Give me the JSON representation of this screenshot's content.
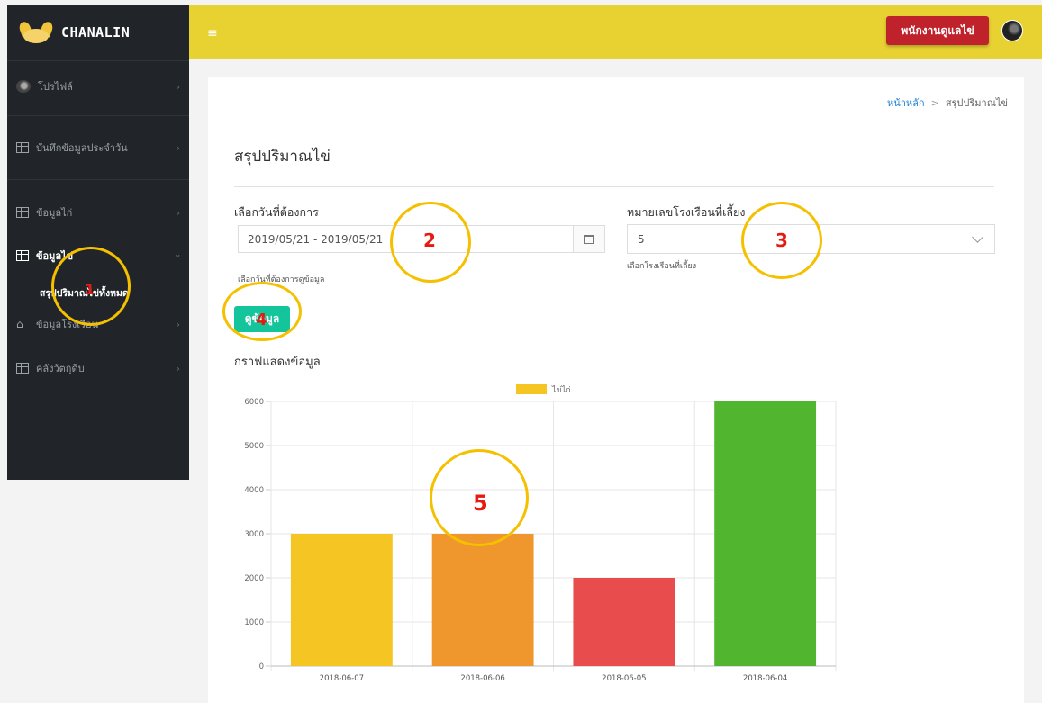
{
  "brand": {
    "name": "CHANALIN"
  },
  "sidebar": {
    "items": [
      {
        "label": "โปรไฟล์",
        "icon": "avatar"
      },
      {
        "label": "บันทึกข้อมูลประจำวัน",
        "icon": "table-icon"
      },
      {
        "label": "ข้อมูลไก่",
        "icon": "table-icon"
      },
      {
        "label": "ข้อมูลไข่",
        "icon": "table-icon"
      },
      {
        "label": "ข้อมูลโรงเรือน",
        "icon": "home-icon"
      },
      {
        "label": "คลังวัตถุดิบ",
        "icon": "table-icon"
      }
    ],
    "sub_item": "สรุปปริมาณไข่ทั้งหมด"
  },
  "topbar": {
    "menu_icon": "hamburger-icon",
    "role_button": "พนักงานดูแลไข่"
  },
  "breadcrumb": {
    "home": "หน้าหลัก",
    "separator": ">",
    "current": "สรุปปริมาณไข่"
  },
  "page": {
    "title": "สรุปปริมาณไข่"
  },
  "form": {
    "date_label": "เลือกวันที่ต้องการ",
    "date_value": "2019/05/21 - 2019/05/21",
    "date_help": "เลือกวันที่ต้องการดูข้อมูล",
    "house_label": "หมายเลขโรงเรือนที่เลี้ยง",
    "house_value": "5",
    "house_help": "เลือกโรงเรือนที่เลี้ยง",
    "view_button": "ดูข้อมูล"
  },
  "chart_heading": "กราฟแสดงข้อมูล",
  "chart_data": {
    "type": "bar",
    "categories": [
      "2018-06-07",
      "2018-06-06",
      "2018-06-05",
      "2018-06-04"
    ],
    "series": [
      {
        "name": "ไข่ไก่",
        "values": [
          3000,
          3000,
          2000,
          6000
        ]
      }
    ],
    "bar_colors": [
      "#f5c523",
      "#ef962d",
      "#e84c4c",
      "#52b530"
    ],
    "legend_color": "#f5c523",
    "legend_position": "top",
    "yticks": [
      0,
      1000,
      2000,
      3000,
      4000,
      5000,
      6000
    ],
    "ylim": [
      0,
      6000
    ],
    "grid": true
  },
  "annotations": [
    "1",
    "2",
    "3",
    "4",
    "5"
  ],
  "colors": {
    "sidebar": "#212529",
    "topbar": "#e8d232",
    "role_button": "#c0222c",
    "view_button": "#14c49a",
    "annotation_ring": "#f5c000",
    "annotation_number": "#e51b12"
  }
}
